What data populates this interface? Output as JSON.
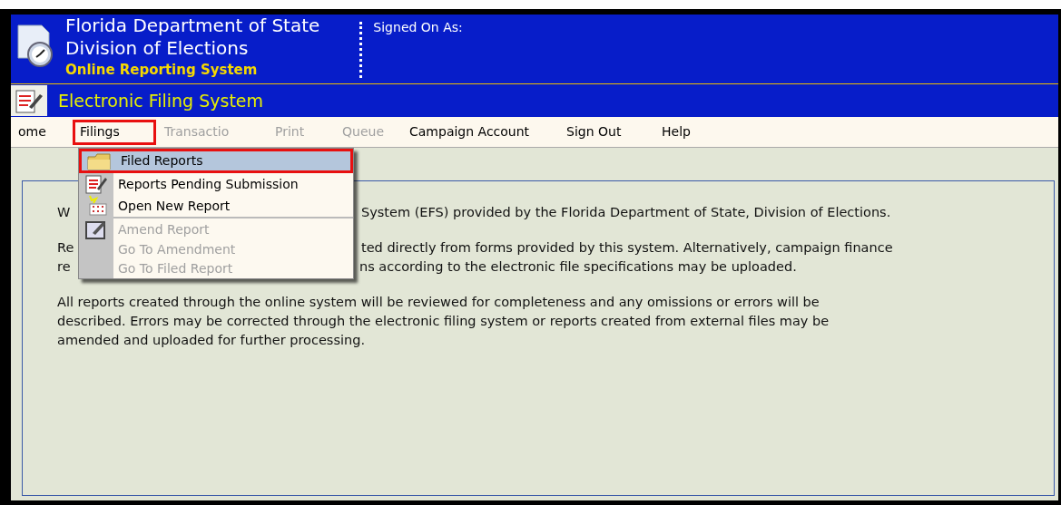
{
  "header": {
    "title_lines": [
      "Florida Department of State",
      "Division of Elections"
    ],
    "subtitle": "Online Reporting System",
    "signed_on_label": "Signed On As:"
  },
  "system_bar": {
    "title": "Electronic Filing System"
  },
  "nav": [
    {
      "label": "ome",
      "selected": false,
      "disabled": false
    },
    {
      "label": "Filings",
      "selected": true,
      "disabled": false
    },
    {
      "label": "Transactio",
      "selected": false,
      "disabled": true
    },
    {
      "label": "Print",
      "selected": false,
      "disabled": true
    },
    {
      "label": "Queue",
      "selected": false,
      "disabled": true
    },
    {
      "label": "Campaign Account",
      "selected": false,
      "disabled": false
    },
    {
      "label": "Sign Out",
      "selected": false,
      "disabled": false
    },
    {
      "label": "Help",
      "selected": false,
      "disabled": false
    }
  ],
  "dropdown": [
    {
      "label": "Filed Reports",
      "selected": true,
      "disabled": false,
      "divider_after": false
    },
    {
      "label": "Reports Pending Submission",
      "selected": false,
      "disabled": false,
      "divider_after": false
    },
    {
      "label": "Open New Report",
      "selected": false,
      "disabled": false,
      "divider_after": true
    },
    {
      "label": "Amend Report",
      "selected": false,
      "disabled": true,
      "divider_after": false
    },
    {
      "label": "Go To Amendment",
      "selected": false,
      "disabled": true,
      "divider_after": false
    },
    {
      "label": "Go To Filed Report",
      "selected": false,
      "disabled": true,
      "divider_after": false
    }
  ],
  "content": {
    "paragraphs": [
      {
        "lines": [
          {
            "left": "W",
            "right": "System (EFS) provided by the Florida Department of State, Division of Elections."
          }
        ]
      },
      {
        "lines": [
          {
            "left": "Re",
            "right": "ted directly from forms provided by this system. Alternatively, campaign finance"
          },
          {
            "left": "re",
            "right": "ns according to the electronic file specifications may be uploaded."
          }
        ]
      },
      {
        "lines": [
          {
            "left": "All reports created through the online system will be reviewed for completeness and any omissions or errors will be"
          },
          {
            "left": "described. Errors may be corrected through the electronic filing system or reports created from external files may be"
          },
          {
            "left": "amended and uploaded for further processing."
          }
        ]
      }
    ]
  }
}
